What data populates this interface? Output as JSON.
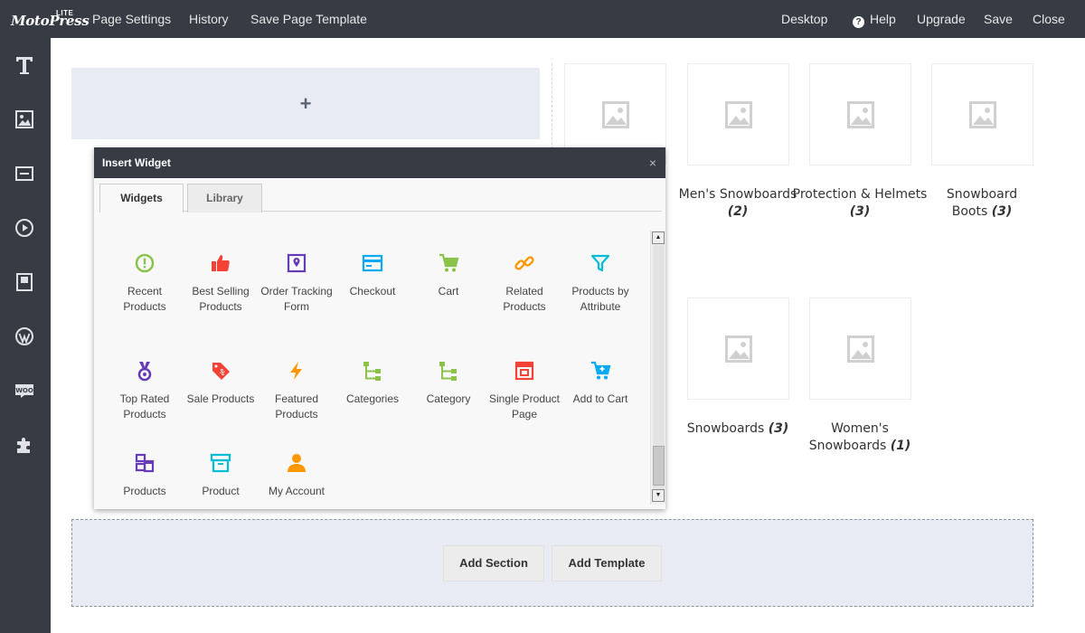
{
  "logo": {
    "text": "MotoPress",
    "badge": "LITE"
  },
  "topbar": {
    "left": [
      "Page Settings",
      "History",
      "Save Page Template"
    ],
    "device": "Desktop",
    "help": "Help",
    "upgrade": "Upgrade",
    "save": "Save",
    "close": "Close"
  },
  "sidebar_icons": [
    "text-icon",
    "image-icon",
    "button-icon",
    "video-icon",
    "layout-icon",
    "wordpress-icon",
    "woocommerce-icon",
    "plugin-icon"
  ],
  "canvas": {
    "add_symbol": "+"
  },
  "products": [
    {
      "name": "Men's Snowboards",
      "count": "(2)"
    },
    {
      "name": "Protection & Helmets",
      "count": "(3)"
    },
    {
      "name": "Snowboard Boots",
      "count": "(3)"
    },
    {
      "name": "Snowboards",
      "count": "(3)"
    },
    {
      "name": "Women's Snowboards",
      "count": "(1)"
    }
  ],
  "dialog": {
    "title": "Insert Widget",
    "close_symbol": "×",
    "tabs": [
      "Widgets",
      "Library"
    ],
    "widgets": [
      {
        "label": "Recent Products",
        "icon": "exclamation-circle-icon",
        "color": "#8bc34a"
      },
      {
        "label": "Best Selling Products",
        "icon": "thumbs-up-icon",
        "color": "#f44336"
      },
      {
        "label": "Order Tracking Form",
        "icon": "map-pin-icon",
        "color": "#673ab7"
      },
      {
        "label": "Checkout",
        "icon": "credit-card-icon",
        "color": "#03a9f4"
      },
      {
        "label": "Cart",
        "icon": "cart-icon",
        "color": "#8bc34a"
      },
      {
        "label": "Related Products",
        "icon": "link-icon",
        "color": "#ff9800"
      },
      {
        "label": "Products by Attribute",
        "icon": "filter-icon",
        "color": "#00bcd4"
      },
      {
        "label": "Top Rated Products",
        "icon": "medal-icon",
        "color": "#673ab7"
      },
      {
        "label": "Sale Products",
        "icon": "sale-tag-icon",
        "color": "#f44336"
      },
      {
        "label": "Featured Products",
        "icon": "lightning-icon",
        "color": "#ff9800"
      },
      {
        "label": "Categories",
        "icon": "tree-icon",
        "color": "#8bc34a"
      },
      {
        "label": "Category",
        "icon": "tree-icon",
        "color": "#8bc34a"
      },
      {
        "label": "Single Product Page",
        "icon": "product-page-icon",
        "color": "#f44336"
      },
      {
        "label": "Add to Cart",
        "icon": "add-to-cart-icon",
        "color": "#03a9f4"
      },
      {
        "label": "Products",
        "icon": "boxes-icon",
        "color": "#673ab7"
      },
      {
        "label": "Product",
        "icon": "box-icon",
        "color": "#00bcd4"
      },
      {
        "label": "My Account",
        "icon": "user-icon",
        "color": "#ff9800"
      }
    ]
  },
  "bottom": {
    "add_section": "Add Section",
    "add_template": "Add Template"
  }
}
